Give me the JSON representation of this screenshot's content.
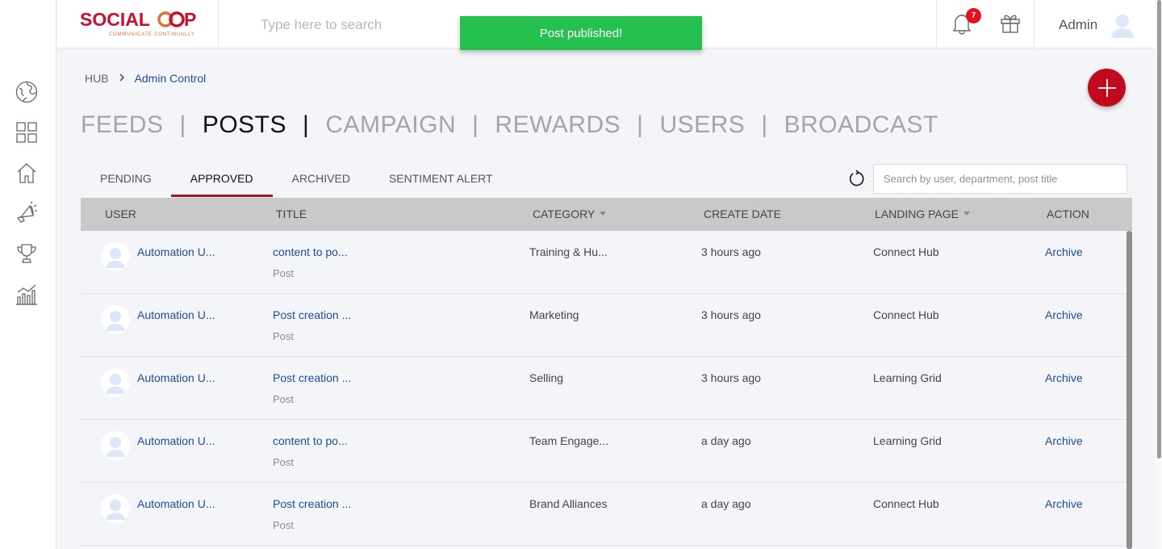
{
  "brand": {
    "logo": "SOCIALCOOP",
    "tagline": "COMMUNICATE CONTINUALLY",
    "accent": "#c20a1e"
  },
  "topbar": {
    "search_placeholder": "Type here to search",
    "notification_count": "7",
    "user_name": "Admin"
  },
  "toast": {
    "message": "Post published!",
    "color": "#26c04f"
  },
  "breadcrumb": {
    "root": "HUB",
    "separator": "›",
    "current": "Admin Control"
  },
  "main_tabs": [
    "FEEDS",
    "POSTS",
    "CAMPAIGN",
    "REWARDS",
    "USERS",
    "BROADCAST"
  ],
  "main_tab_separator": "|",
  "active_main_tab": "POSTS",
  "sub_tabs": [
    "PENDING",
    "APPROVED",
    "ARCHIVED",
    "SENTIMENT ALERT"
  ],
  "active_sub_tab": "APPROVED",
  "table_search_placeholder": "Search by user, department, post title",
  "columns": {
    "user": "USER",
    "title": "TITLE",
    "category": "CATEGORY",
    "create_date": "CREATE DATE",
    "landing_page": "LANDING PAGE",
    "action": "ACTION"
  },
  "rows": [
    {
      "user": "Automation U...",
      "title": "content to po...",
      "type": "Post",
      "category": "Training & Hu...",
      "date": "3 hours ago",
      "landing": "Connect Hub",
      "action": "Archive"
    },
    {
      "user": "Automation U...",
      "title": "Post creation ...",
      "type": "Post",
      "category": "Marketing",
      "date": "3 hours ago",
      "landing": "Connect Hub",
      "action": "Archive"
    },
    {
      "user": "Automation U...",
      "title": "Post creation ...",
      "type": "Post",
      "category": "Selling",
      "date": "3 hours ago",
      "landing": "Learning Grid",
      "action": "Archive"
    },
    {
      "user": "Automation U...",
      "title": "content to po...",
      "type": "Post",
      "category": "Team Engage...",
      "date": "a day ago",
      "landing": "Learning Grid",
      "action": "Archive"
    },
    {
      "user": "Automation U...",
      "title": "Post creation ...",
      "type": "Post",
      "category": "Brand Alliances",
      "date": "a day ago",
      "landing": "Connect Hub",
      "action": "Archive"
    }
  ],
  "left_nav_icons": [
    "globe-icon",
    "grid-icon",
    "home-icon",
    "megaphone-icon",
    "trophy-icon",
    "analytics-icon"
  ]
}
